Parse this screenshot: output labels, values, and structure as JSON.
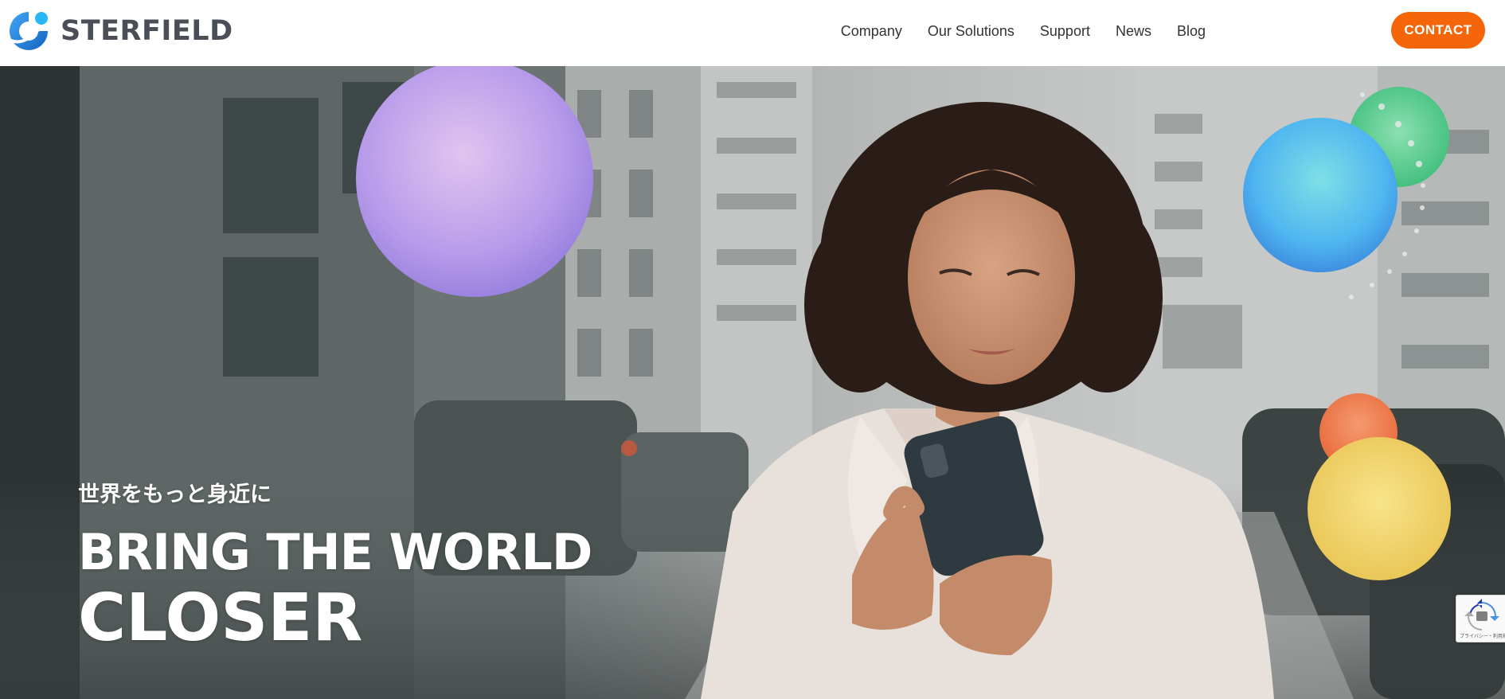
{
  "brand": {
    "name": "STERFIELD",
    "logo_icon": "globe-orbit-logo-icon",
    "text_color": "#4a4f57",
    "mark_color": "#1e88e5"
  },
  "nav": {
    "items": [
      {
        "label": "Company"
      },
      {
        "label": "Our Solutions"
      },
      {
        "label": "Support"
      },
      {
        "label": "News"
      },
      {
        "label": "Blog"
      }
    ],
    "contact_label": "CONTACT",
    "contact_color": "#f5660b"
  },
  "hero": {
    "subtitle": "世界をもっと身近に",
    "title_line1": "BRING THE WORLD",
    "title_line2": "CLOSER",
    "background": "street-scene-woman-with-smartphone",
    "orbs": [
      {
        "name": "purple-orb",
        "color": "#c9a9ec"
      },
      {
        "name": "green-orb",
        "color": "#5ed293"
      },
      {
        "name": "blue-orb",
        "color": "#4fb6f0"
      },
      {
        "name": "orange-orb",
        "color": "#f5845a"
      },
      {
        "name": "yellow-orb",
        "color": "#f2d770"
      }
    ]
  },
  "recaptcha": {
    "icon": "recaptcha-icon",
    "legal_text": "プライバシー・利用規約"
  }
}
